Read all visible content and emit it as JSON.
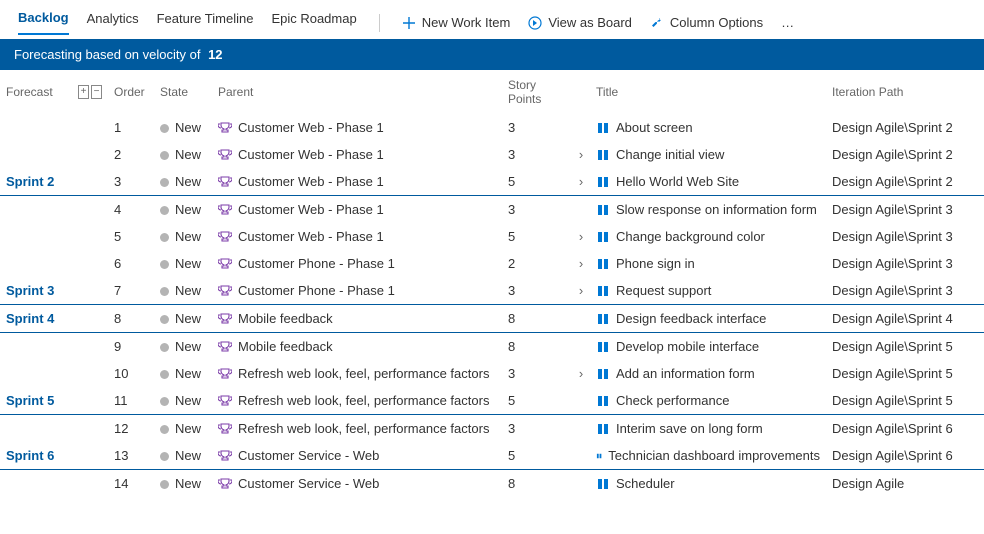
{
  "toolbar": {
    "tabs": [
      {
        "label": "Backlog",
        "active": true
      },
      {
        "label": "Analytics"
      },
      {
        "label": "Feature Timeline"
      },
      {
        "label": "Epic Roadmap"
      }
    ],
    "commands": [
      {
        "label": "New Work Item",
        "icon": "plus"
      },
      {
        "label": "View as Board",
        "icon": "arrow-circle"
      },
      {
        "label": "Column Options",
        "icon": "wrench"
      }
    ],
    "overflow": "…"
  },
  "banner": {
    "text": "Forecasting based on velocity of",
    "value": "12"
  },
  "columns": {
    "forecast": "Forecast",
    "order": "Order",
    "state": "State",
    "parent": "Parent",
    "sp": "Story Points",
    "title": "Title",
    "iter": "Iteration Path"
  },
  "state_label": "New",
  "rows": [
    {
      "forecast": "",
      "order": "1",
      "parent": "Customer Web - Phase 1",
      "sp": "3",
      "chev": false,
      "title": "About screen",
      "iter": "Design Agile\\Sprint 2",
      "sep": false
    },
    {
      "forecast": "",
      "order": "2",
      "parent": "Customer Web - Phase 1",
      "sp": "3",
      "chev": true,
      "title": "Change initial view",
      "iter": "Design Agile\\Sprint 2",
      "sep": false
    },
    {
      "forecast": "Sprint 2",
      "order": "3",
      "parent": "Customer Web - Phase 1",
      "sp": "5",
      "chev": true,
      "title": "Hello World Web Site",
      "iter": "Design Agile\\Sprint 2",
      "sep": true
    },
    {
      "forecast": "",
      "order": "4",
      "parent": "Customer Web - Phase 1",
      "sp": "3",
      "chev": false,
      "title": "Slow response on information form",
      "iter": "Design Agile\\Sprint 3",
      "sep": false
    },
    {
      "forecast": "",
      "order": "5",
      "parent": "Customer Web - Phase 1",
      "sp": "5",
      "chev": true,
      "title": "Change background color",
      "iter": "Design Agile\\Sprint 3",
      "sep": false
    },
    {
      "forecast": "",
      "order": "6",
      "parent": "Customer Phone - Phase 1",
      "sp": "2",
      "chev": true,
      "title": "Phone sign in",
      "iter": "Design Agile\\Sprint 3",
      "sep": false
    },
    {
      "forecast": "Sprint 3",
      "order": "7",
      "parent": "Customer Phone - Phase 1",
      "sp": "3",
      "chev": true,
      "title": "Request support",
      "iter": "Design Agile\\Sprint 3",
      "sep": true
    },
    {
      "forecast": "Sprint 4",
      "order": "8",
      "parent": "Mobile feedback",
      "sp": "8",
      "chev": false,
      "title": "Design feedback interface",
      "iter": "Design Agile\\Sprint 4",
      "sep": true
    },
    {
      "forecast": "",
      "order": "9",
      "parent": "Mobile feedback",
      "sp": "8",
      "chev": false,
      "title": "Develop mobile interface",
      "iter": "Design Agile\\Sprint 5",
      "sep": false
    },
    {
      "forecast": "",
      "order": "10",
      "parent": "Refresh web look, feel, performance factors",
      "sp": "3",
      "chev": true,
      "title": "Add an information form",
      "iter": "Design Agile\\Sprint 5",
      "sep": false
    },
    {
      "forecast": "Sprint 5",
      "order": "11",
      "parent": "Refresh web look, feel, performance factors",
      "sp": "5",
      "chev": false,
      "title": "Check performance",
      "iter": "Design Agile\\Sprint 5",
      "sep": true
    },
    {
      "forecast": "",
      "order": "12",
      "parent": "Refresh web look, feel, performance factors",
      "sp": "3",
      "chev": false,
      "title": "Interim save on long form",
      "iter": "Design Agile\\Sprint 6",
      "sep": false
    },
    {
      "forecast": "Sprint 6",
      "order": "13",
      "parent": "Customer Service - Web",
      "sp": "5",
      "chev": false,
      "title": "Technician dashboard improvements",
      "iter": "Design Agile\\Sprint 6",
      "sep": true
    },
    {
      "forecast": "",
      "order": "14",
      "parent": "Customer Service - Web",
      "sp": "8",
      "chev": false,
      "title": "Scheduler",
      "iter": "Design Agile",
      "sep": false
    }
  ]
}
